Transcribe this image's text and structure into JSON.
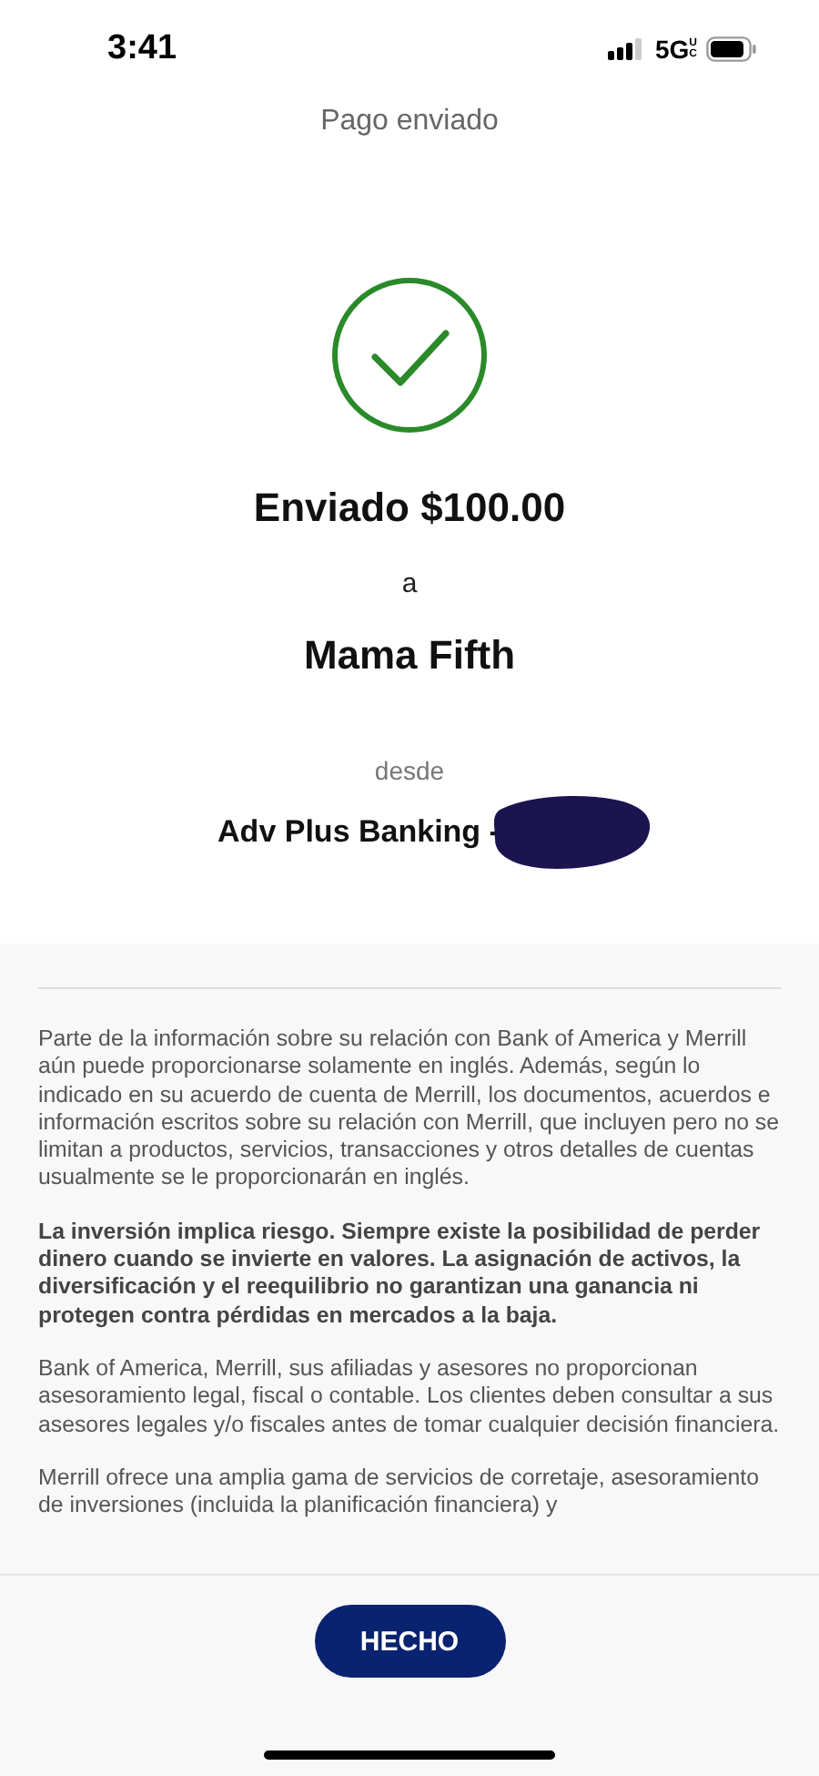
{
  "status_bar": {
    "time": "3:41",
    "network": "5G",
    "network_suffix": "UC"
  },
  "header": {
    "title": "Pago enviado"
  },
  "confirmation": {
    "amount_line": "Enviado $100.00",
    "connector": "a",
    "recipient": "Mama Fifth",
    "from_label": "desde",
    "account": "Adv Plus Banking -"
  },
  "disclosures": [
    {
      "kind": "plain",
      "text": "Parte de la información sobre su relación con Bank of America y Merrill aún puede proporcionarse solamente en inglés. Además, según lo indicado en su acuerdo de cuenta de Merrill, los documentos, acuerdos e información escritos sobre su relación con Merrill, que incluyen pero no se limitan a productos, servicios, transacciones y otros detalles de cuentas usualmente se le proporcionarán en inglés."
    },
    {
      "kind": "bold",
      "text": "La inversión implica riesgo. Siempre existe la posibilidad de perder dinero cuando se invierte en valores. La asignación de activos, la diversificación y el reequilibrio no garantizan una ganancia ni protegen contra pérdidas en mercados a la baja."
    },
    {
      "kind": "plain",
      "text": "Bank of America, Merrill, sus afiliadas y asesores no proporcionan asesoramiento legal, fiscal o contable. Los clientes deben consultar a sus asesores legales y/o fiscales antes de tomar cualquier decisión financiera."
    },
    {
      "kind": "plain",
      "text": "Merrill ofrece una amplia gama de servicios de corretaje, asesoramiento de inversiones (incluida la planificación financiera) y"
    }
  ],
  "button": "HECHO"
}
